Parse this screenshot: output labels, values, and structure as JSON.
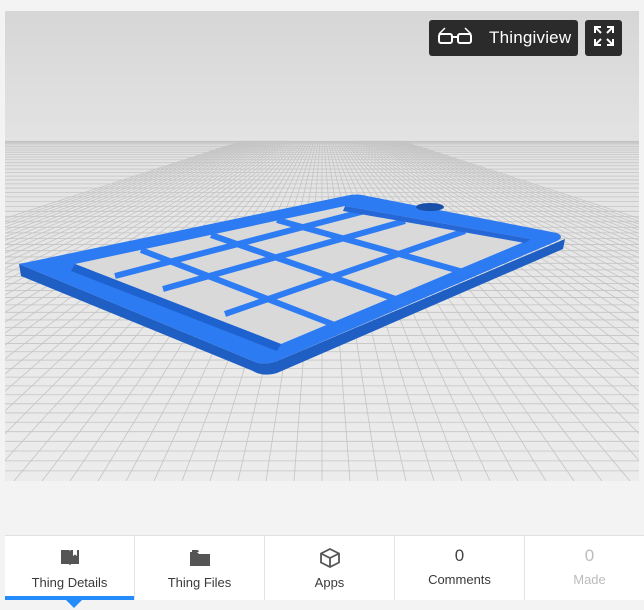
{
  "viewer": {
    "thingiview_label": "Thingiview",
    "icons": [
      "3d-glasses-icon",
      "fullscreen-icon"
    ],
    "model_color": "#2d7bf2"
  },
  "tabs": [
    {
      "label": "Thing Details",
      "icon": "book-icon",
      "active": true
    },
    {
      "label": "Thing Files",
      "icon": "folder-icon"
    },
    {
      "label": "Apps",
      "icon": "cube-icon"
    },
    {
      "label": "Comments",
      "count": "0"
    },
    {
      "label": "Made",
      "count": "0"
    }
  ],
  "colors": {
    "accent": "#248bfb",
    "button_bg": "#2b2b2b"
  }
}
